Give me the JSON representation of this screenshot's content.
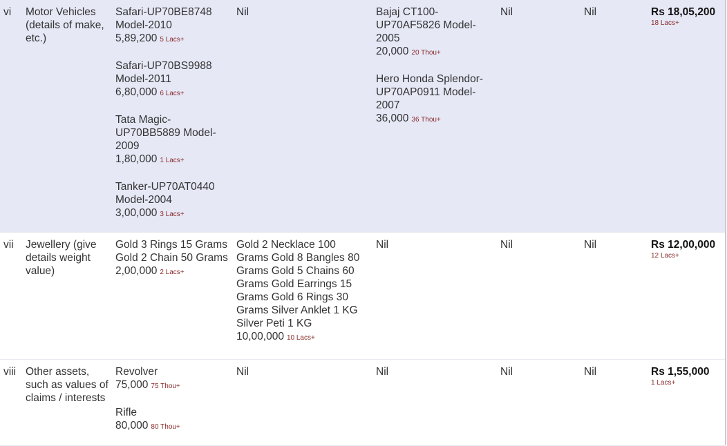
{
  "colors": {
    "highlight_row": "#e6e8f6",
    "approx_text": "#8b2c2c"
  },
  "rows": [
    {
      "num": "vi",
      "label": "Motor Vehicles (details of make, etc.)",
      "cols": [
        [
          {
            "desc": "Safari-UP70BE8748 Model-2010",
            "value": "5,89,200",
            "approx": "5 Lacs+"
          },
          {
            "desc": "Safari-UP70BS9988 Model-2011",
            "value": "6,80,000",
            "approx": "6 Lacs+"
          },
          {
            "desc": "Tata Magic-UP70BB5889 Model-2009",
            "value": "1,80,000",
            "approx": "1 Lacs+"
          },
          {
            "desc": "Tanker-UP70AT0440 Model-2004",
            "value": "3,00,000",
            "approx": "3 Lacs+"
          }
        ],
        [
          {
            "desc": "Nil"
          }
        ],
        [
          {
            "desc": "Bajaj CT100-UP70AF5826 Model-2005",
            "value": "20,000",
            "approx": "20 Thou+"
          },
          {
            "desc": "Hero Honda Splendor-UP70AP0911 Model-2007",
            "value": "36,000",
            "approx": "36 Thou+"
          }
        ],
        [
          {
            "desc": "Nil"
          }
        ],
        [
          {
            "desc": "Nil"
          }
        ]
      ],
      "total": "Rs 18,05,200",
      "total_approx": "18 Lacs+"
    },
    {
      "num": "vii",
      "label": "Jewellery (give details weight value)",
      "cols": [
        [
          {
            "desc": "Gold 3 Rings 15 Grams Gold 2 Chain 50 Grams",
            "value": "2,00,000",
            "approx": "2 Lacs+"
          }
        ],
        [
          {
            "desc": "Gold 2 Necklace 100 Grams Gold 8 Bangles 80 Grams Gold 5 Chains 60 Grams Gold Earrings 15 Grams Gold 6 Rings 30 Grams Silver Anklet 1 KG Silver Peti 1 KG",
            "value": "10,00,000",
            "approx": "10 Lacs+"
          }
        ],
        [
          {
            "desc": "Nil"
          }
        ],
        [
          {
            "desc": "Nil"
          }
        ],
        [
          {
            "desc": "Nil"
          }
        ]
      ],
      "total": "Rs 12,00,000",
      "total_approx": "12 Lacs+"
    },
    {
      "num": "viii",
      "label": "Other assets, such as values of claims / interests",
      "cols": [
        [
          {
            "desc": "Revolver",
            "value": "75,000",
            "approx": "75 Thou+"
          },
          {
            "desc": "Rifle",
            "value": "80,000",
            "approx": "80 Thou+"
          }
        ],
        [
          {
            "desc": "Nil"
          }
        ],
        [
          {
            "desc": "Nil"
          }
        ],
        [
          {
            "desc": "Nil"
          }
        ],
        [
          {
            "desc": "Nil"
          }
        ]
      ],
      "total": "Rs 1,55,000",
      "total_approx": "1 Lacs+"
    }
  ]
}
